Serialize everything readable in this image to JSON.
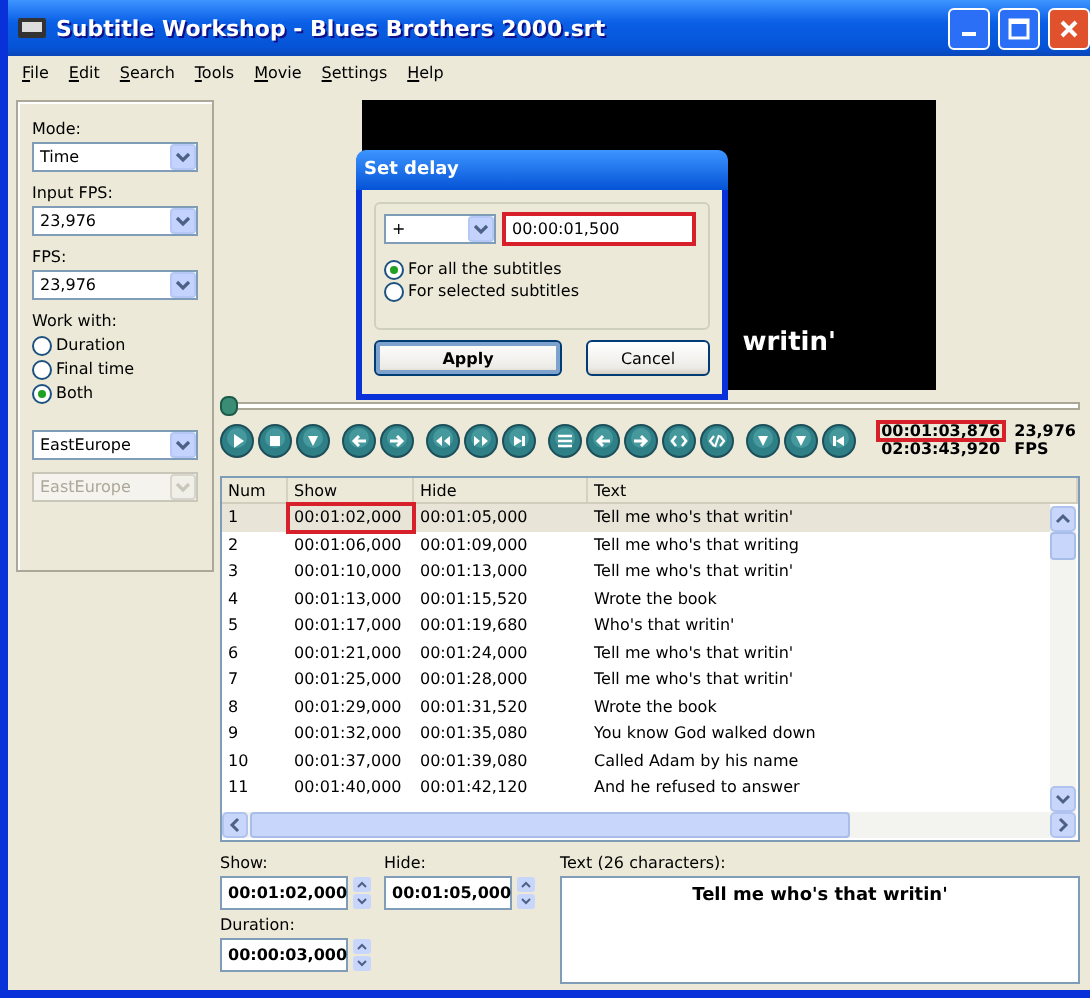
{
  "window": {
    "title": "Subtitle Workshop - Blues Brothers 2000.srt"
  },
  "menu": [
    "File",
    "Edit",
    "Search",
    "Tools",
    "Movie",
    "Settings",
    "Help"
  ],
  "sidebar": {
    "selects": [
      {
        "label": "Mode:",
        "value": "Time"
      },
      {
        "label": "Input FPS:",
        "value": "23,976"
      },
      {
        "label": "FPS:",
        "value": "23,976"
      }
    ],
    "work_with": {
      "label": "Work with:",
      "options": [
        {
          "label": "Duration",
          "selected": false
        },
        {
          "label": "Final time",
          "selected": false
        },
        {
          "label": "Both",
          "selected": true
        }
      ]
    },
    "charsets": [
      {
        "value": "EastEurope",
        "disabled": false
      },
      {
        "value": "EastEurope",
        "disabled": true
      }
    ]
  },
  "video": {
    "subtitle": "writin'"
  },
  "player": {
    "level": 0.0,
    "current_time": "00:01:03,876",
    "current_highlighted": true,
    "total_time": "02:03:43,920",
    "fps": "23,976",
    "fps_unit": "FPS"
  },
  "table": {
    "columns": [
      "Num",
      "Show",
      "Hide",
      "Text"
    ],
    "rows": [
      {
        "cells": [
          "1",
          "00:01:02,000",
          "00:01:05,000",
          "Tell me who's that writin'"
        ],
        "selected": true,
        "show_highlighted": true
      },
      {
        "cells": [
          "2",
          "00:01:06,000",
          "00:01:09,000",
          "Tell me who's that writing"
        ],
        "selected": false,
        "show_highlighted": false
      },
      {
        "cells": [
          "3",
          "00:01:10,000",
          "00:01:13,000",
          "Tell me who's that writin'"
        ],
        "selected": false,
        "show_highlighted": false
      },
      {
        "cells": [
          "4",
          "00:01:13,000",
          "00:01:15,520",
          "Wrote the book"
        ],
        "selected": false,
        "show_highlighted": false
      },
      {
        "cells": [
          "5",
          "00:01:17,000",
          "00:01:19,680",
          "Who's that writin'"
        ],
        "selected": false,
        "show_highlighted": false
      },
      {
        "cells": [
          "6",
          "00:01:21,000",
          "00:01:24,000",
          "Tell me who's that writin'"
        ],
        "selected": false,
        "show_highlighted": false
      },
      {
        "cells": [
          "7",
          "00:01:25,000",
          "00:01:28,000",
          "Tell me who's that writin'"
        ],
        "selected": false,
        "show_highlighted": false
      },
      {
        "cells": [
          "8",
          "00:01:29,000",
          "00:01:31,520",
          "Wrote the book"
        ],
        "selected": false,
        "show_highlighted": false
      },
      {
        "cells": [
          "9",
          "00:01:32,000",
          "00:01:35,080",
          "You know God walked down"
        ],
        "selected": false,
        "show_highlighted": false
      },
      {
        "cells": [
          "10",
          "00:01:37,000",
          "00:01:39,080",
          "Called Adam by his name"
        ],
        "selected": false,
        "show_highlighted": false
      },
      {
        "cells": [
          "11",
          "00:01:40,000",
          "00:01:42,120",
          "And he refused to answer"
        ],
        "selected": false,
        "show_highlighted": false
      }
    ]
  },
  "editor": {
    "show": {
      "label": "Show:",
      "value": "00:01:02,000"
    },
    "hide": {
      "label": "Hide:",
      "value": "00:01:05,000"
    },
    "duration": {
      "label": "Duration:",
      "value": "00:00:03,000"
    },
    "text_label": "Text (26 characters):",
    "text": "Tell me who's that writin'"
  },
  "dialog": {
    "title": "Set delay",
    "sign": "+",
    "delay": "00:00:01,500",
    "delay_highlighted": true,
    "options": [
      {
        "label": "For all the subtitles",
        "selected": true
      },
      {
        "label": "For selected subtitles",
        "selected": false
      }
    ],
    "buttons": [
      {
        "label": "Apply",
        "default": true
      },
      {
        "label": "Cancel",
        "default": false
      }
    ]
  }
}
